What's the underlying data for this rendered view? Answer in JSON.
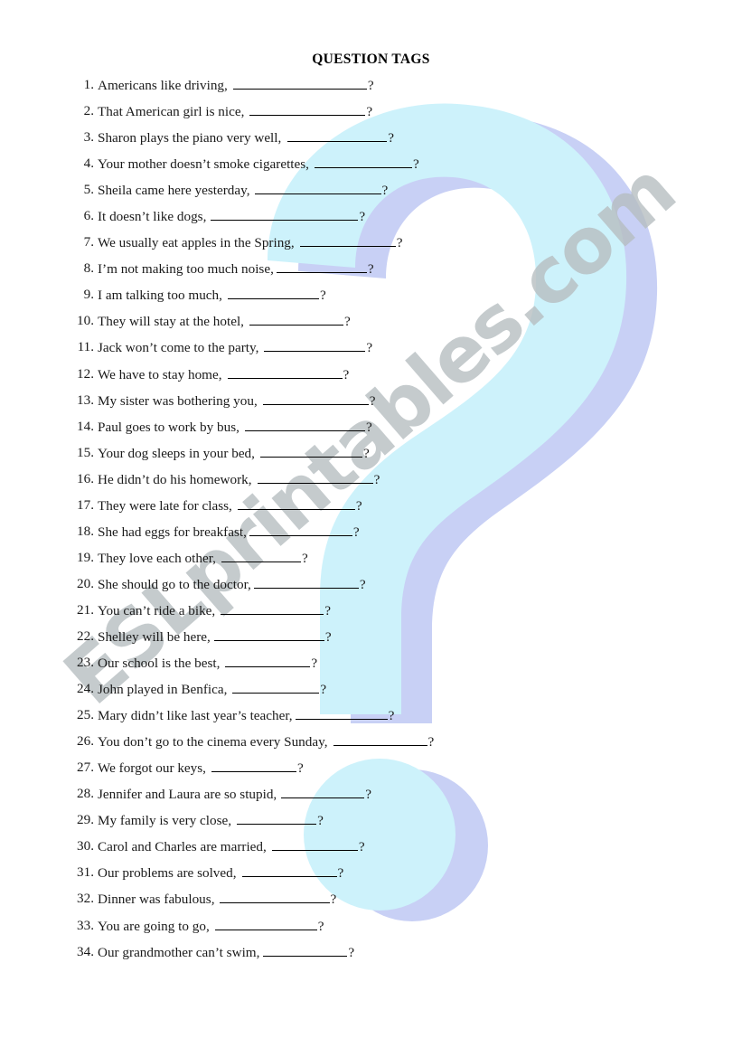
{
  "document": {
    "title": "QUESTION TAGS",
    "watermark_text": "ESLprintables.com",
    "decoration_icon": "question-mark-graphic",
    "colors": {
      "question_mark_fill": "#CDF2FB",
      "question_mark_shadow": "#C8D0F5",
      "watermark": "#B6BDC0",
      "text": "#1A1A1A",
      "page_background": "#FFFFFF"
    }
  },
  "questions": [
    {
      "number": "1.",
      "sentence": "Americans like driving,",
      "blank_width": 148,
      "gap_before_blank": 4,
      "end": "?"
    },
    {
      "number": "2.",
      "sentence": "That American girl is nice,",
      "blank_width": 128,
      "gap_before_blank": 4,
      "end": "?"
    },
    {
      "number": "3.",
      "sentence": "Sharon plays the piano very well,",
      "blank_width": 110,
      "gap_before_blank": 5,
      "end": "?"
    },
    {
      "number": "4.",
      "sentence": "Your mother doesn’t smoke cigarettes,",
      "blank_width": 108,
      "gap_before_blank": 4,
      "end": "?"
    },
    {
      "number": "5.",
      "sentence": "Sheila came here yesterday,",
      "blank_width": 140,
      "gap_before_blank": 3,
      "end": "?"
    },
    {
      "number": "6.",
      "sentence": "It doesn’t like dogs,",
      "blank_width": 163,
      "gap_before_blank": 3,
      "end": "?"
    },
    {
      "number": "7.",
      "sentence": "We usually eat apples in the Spring,",
      "blank_width": 106,
      "gap_before_blank": 4,
      "end": "?"
    },
    {
      "number": "8.",
      "sentence": "I’m not making too much noise,",
      "blank_width": 100,
      "gap_before_blank": 1,
      "end": "?"
    },
    {
      "number": "9.",
      "sentence": "I am talking too much,",
      "blank_width": 101,
      "gap_before_blank": 4,
      "end": "?"
    },
    {
      "number": "10.",
      "sentence": "They will stay at the hotel,",
      "blank_width": 104,
      "gap_before_blank": 4,
      "end": "?"
    },
    {
      "number": "11.",
      "sentence": "Jack won’t come to the party,",
      "blank_width": 112,
      "gap_before_blank": 4,
      "end": "?"
    },
    {
      "number": "12.",
      "sentence": "We have to stay home,",
      "blank_width": 127,
      "gap_before_blank": 4,
      "end": "?"
    },
    {
      "number": "13.",
      "sentence": "My sister was bothering you,",
      "blank_width": 117,
      "gap_before_blank": 4,
      "end": "?"
    },
    {
      "number": "14.",
      "sentence": "Paul goes to work by bus,",
      "blank_width": 133,
      "gap_before_blank": 4,
      "end": "?"
    },
    {
      "number": "15.",
      "sentence": "Your dog sleeps in your bed,",
      "blank_width": 113,
      "gap_before_blank": 4,
      "end": "?"
    },
    {
      "number": "16.",
      "sentence": "He didn’t do his homework,",
      "blank_width": 128,
      "gap_before_blank": 4,
      "end": "?"
    },
    {
      "number": "17.",
      "sentence": " They were late for class,",
      "blank_width": 130,
      "gap_before_blank": 4,
      "end": "?"
    },
    {
      "number": "18.",
      "sentence": "She had eggs for breakfast,",
      "blank_width": 114,
      "gap_before_blank": 1,
      "end": "?"
    },
    {
      "number": "19.",
      "sentence": "They love each other,",
      "blank_width": 88,
      "gap_before_blank": 4,
      "end": "?"
    },
    {
      "number": "20.",
      "sentence": "She should go to the doctor,",
      "blank_width": 116,
      "gap_before_blank": 1,
      "end": "?"
    },
    {
      "number": "21.",
      "sentence": "You can’t ride a bike,",
      "blank_width": 114,
      "gap_before_blank": 4,
      "end": "?"
    },
    {
      "number": "22.",
      "sentence": "Shelley will be here,",
      "blank_width": 122,
      "gap_before_blank": 2,
      "end": "?"
    },
    {
      "number": "23.",
      "sentence": "Our school is the best,",
      "blank_width": 94,
      "gap_before_blank": 4,
      "end": "?"
    },
    {
      "number": "24.",
      "sentence": "John played in Benfica,",
      "blank_width": 96,
      "gap_before_blank": 4,
      "end": "?"
    },
    {
      "number": "25.",
      "sentence": "Mary didn’t like last year’s teacher,",
      "blank_width": 102,
      "gap_before_blank": 1,
      "end": "?"
    },
    {
      "number": "26.",
      "sentence": "You don’t go to the cinema every Sunday,",
      "blank_width": 104,
      "gap_before_blank": 4,
      "end": "?"
    },
    {
      "number": "27.",
      "sentence": "We forgot our keys,",
      "blank_width": 94,
      "gap_before_blank": 4,
      "end": "?"
    },
    {
      "number": "28.",
      "sentence": " Jennifer and Laura are so stupid,",
      "blank_width": 92,
      "gap_before_blank": 3,
      "end": "?"
    },
    {
      "number": "29.",
      "sentence": "My family is very close,",
      "blank_width": 88,
      "gap_before_blank": 4,
      "end": "?"
    },
    {
      "number": "30.",
      "sentence": "Carol and Charles are married,",
      "blank_width": 95,
      "gap_before_blank": 4,
      "end": "?"
    },
    {
      "number": "31.",
      "sentence": "Our problems are solved,",
      "blank_width": 105,
      "gap_before_blank": 4,
      "end": "?"
    },
    {
      "number": "32.",
      "sentence": "Dinner was fabulous,",
      "blank_width": 122,
      "gap_before_blank": 3,
      "end": "?"
    },
    {
      "number": "33.",
      "sentence": "You are going to go,",
      "blank_width": 113,
      "gap_before_blank": 4,
      "end": "?"
    },
    {
      "number": "34.",
      "sentence": "Our grandmother can’t swim,",
      "blank_width": 93,
      "gap_before_blank": 2,
      "end": "?"
    }
  ]
}
